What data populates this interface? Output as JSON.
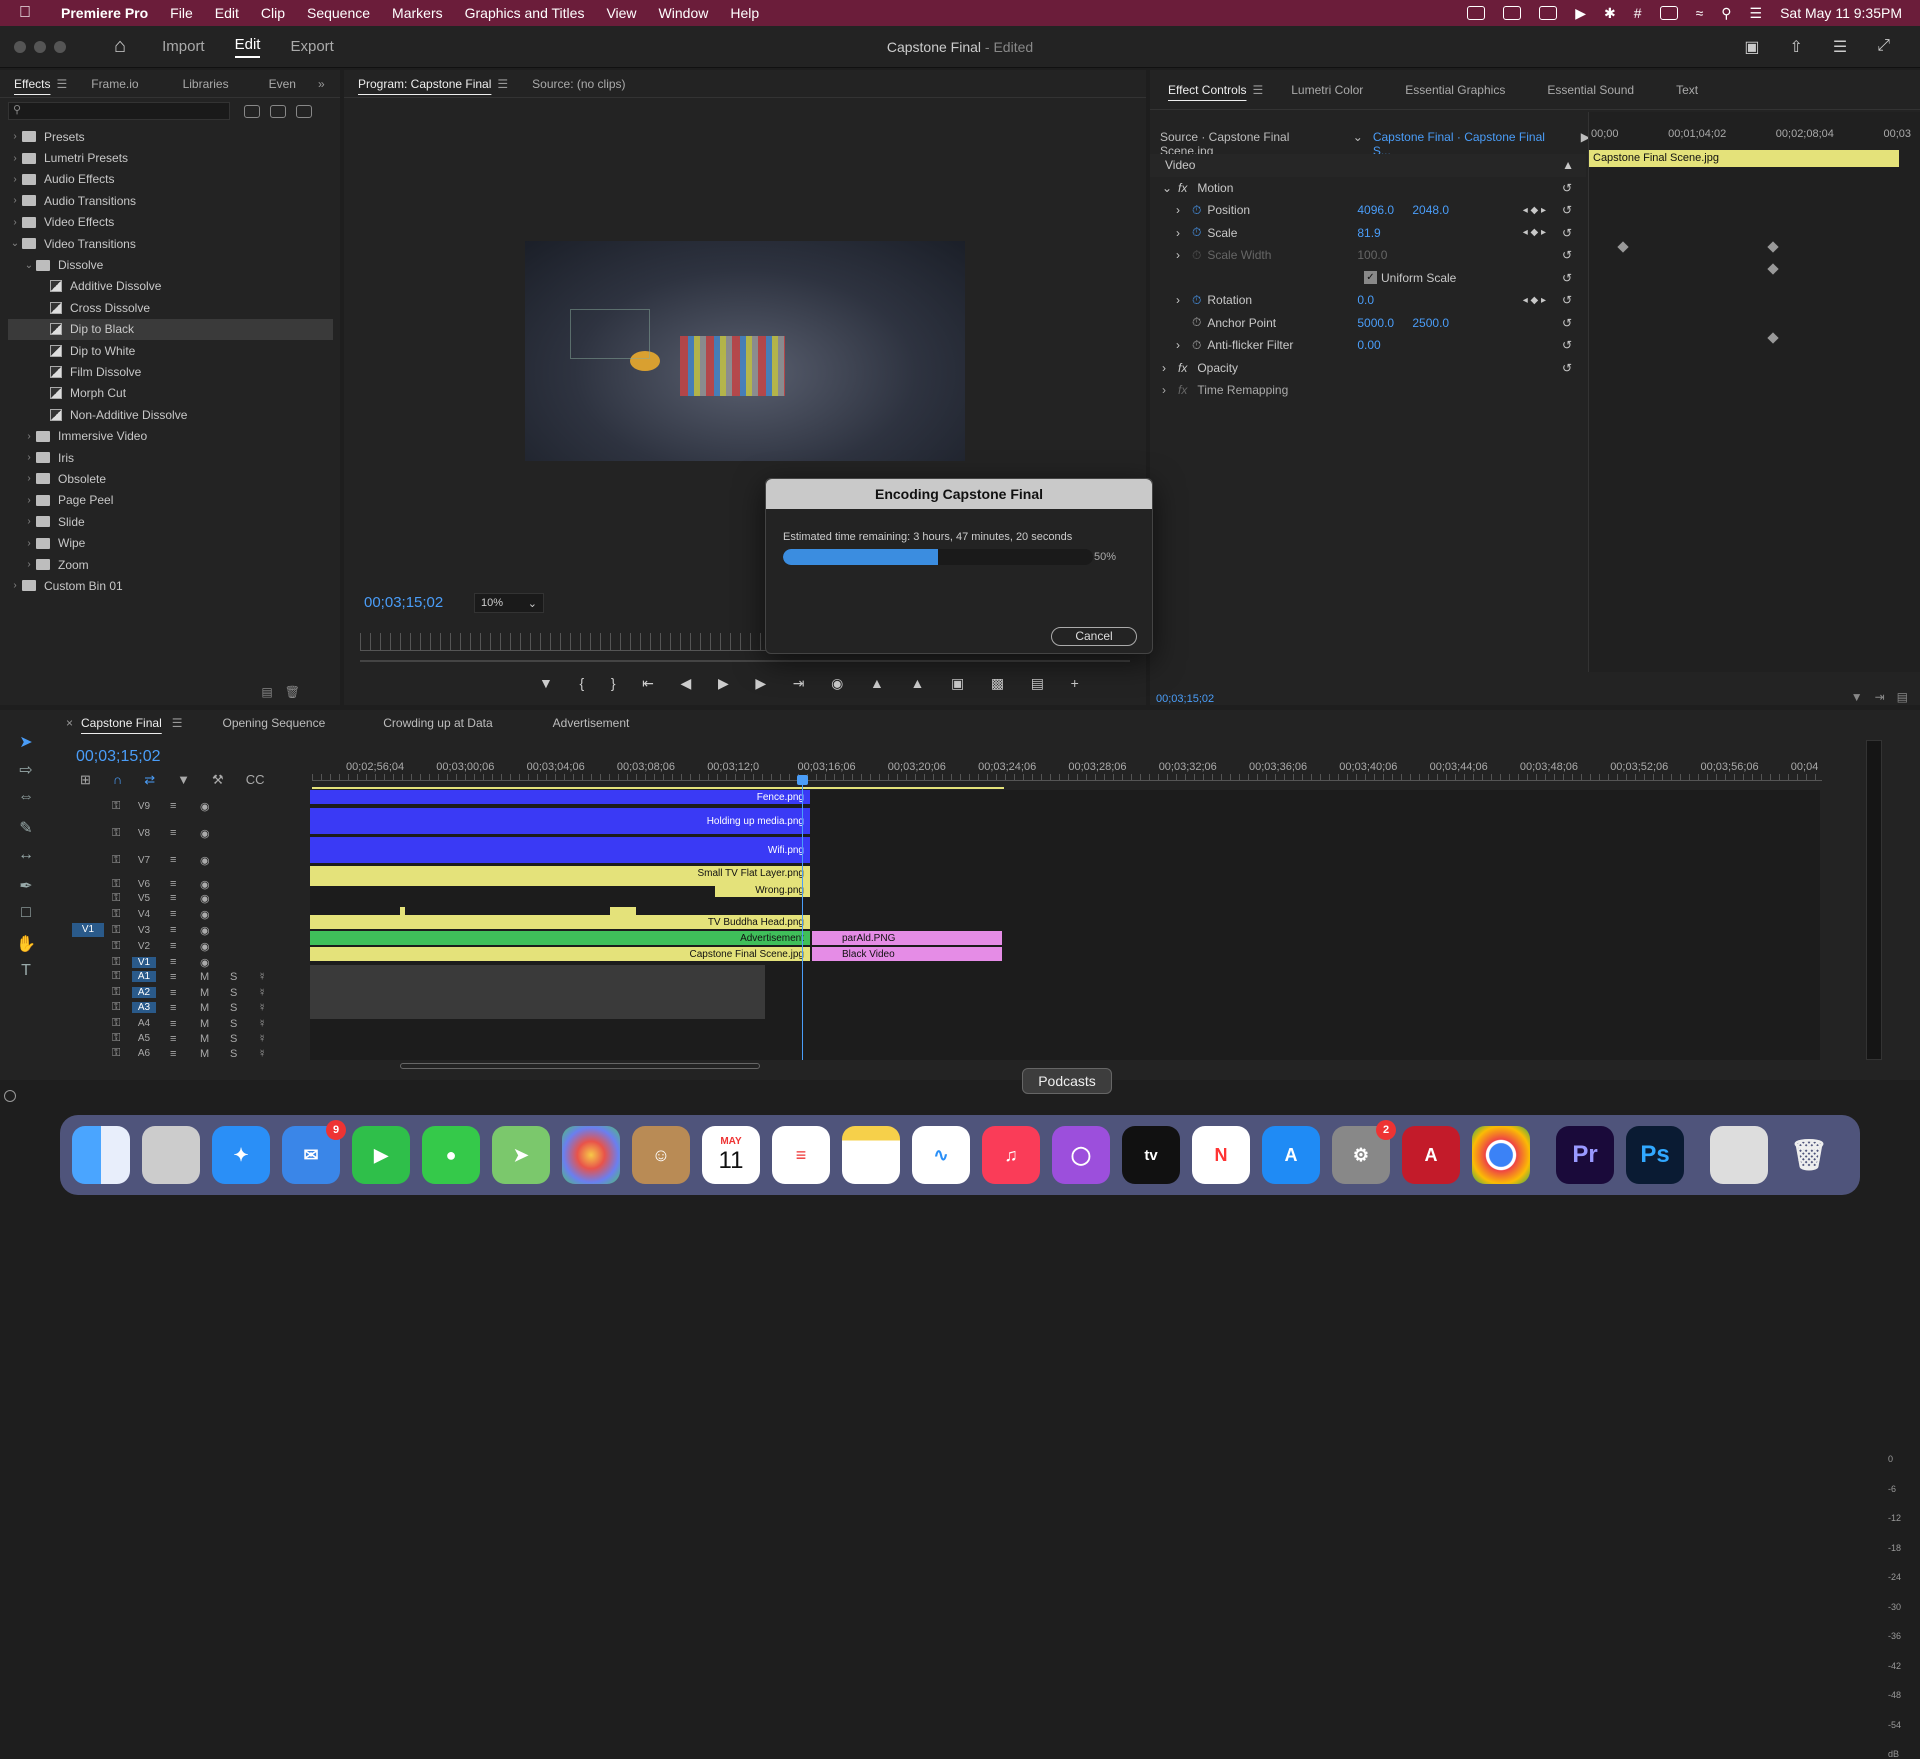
{
  "menubar": {
    "app_name": "Premiere Pro",
    "items": [
      "File",
      "Edit",
      "Clip",
      "Sequence",
      "Markers",
      "Graphics and Titles",
      "View",
      "Window",
      "Help"
    ],
    "datetime": "Sat May 11  9:35PM"
  },
  "header": {
    "tabs": [
      "Import",
      "Edit",
      "Export"
    ],
    "active_tab": "Edit",
    "doc_title": "Capstone Final",
    "doc_state": " - Edited"
  },
  "effects_panel": {
    "tabs": [
      "Effects",
      "Frame.io",
      "Libraries",
      "Even"
    ],
    "tree": [
      {
        "label": "Presets",
        "type": "folder",
        "level": 0
      },
      {
        "label": "Lumetri Presets",
        "type": "folder",
        "level": 0
      },
      {
        "label": "Audio Effects",
        "type": "folder",
        "level": 0
      },
      {
        "label": "Audio Transitions",
        "type": "folder",
        "level": 0
      },
      {
        "label": "Video Effects",
        "type": "folder",
        "level": 0
      },
      {
        "label": "Video Transitions",
        "type": "folder",
        "level": 0,
        "open": true
      },
      {
        "label": "Dissolve",
        "type": "folder",
        "level": 1,
        "open": true
      },
      {
        "label": "Additive Dissolve",
        "type": "fx",
        "level": 2
      },
      {
        "label": "Cross Dissolve",
        "type": "fx",
        "level": 2
      },
      {
        "label": "Dip to Black",
        "type": "fx",
        "level": 2,
        "selected": true
      },
      {
        "label": "Dip to White",
        "type": "fx",
        "level": 2
      },
      {
        "label": "Film Dissolve",
        "type": "fx",
        "level": 2
      },
      {
        "label": "Morph Cut",
        "type": "fx",
        "level": 2
      },
      {
        "label": "Non-Additive Dissolve",
        "type": "fx",
        "level": 2
      },
      {
        "label": "Immersive Video",
        "type": "folder",
        "level": 1
      },
      {
        "label": "Iris",
        "type": "folder",
        "level": 1
      },
      {
        "label": "Obsolete",
        "type": "folder",
        "level": 1
      },
      {
        "label": "Page Peel",
        "type": "folder",
        "level": 1
      },
      {
        "label": "Slide",
        "type": "folder",
        "level": 1
      },
      {
        "label": "Wipe",
        "type": "folder",
        "level": 1
      },
      {
        "label": "Zoom",
        "type": "folder",
        "level": 1
      },
      {
        "label": "Custom Bin 01",
        "type": "folder",
        "level": 0
      }
    ]
  },
  "program_monitor": {
    "tabs": [
      "Program: Capstone Final",
      "Source: (no clips)"
    ],
    "timecode": "00;03;15;02",
    "zoom": "10%"
  },
  "encoding_dialog": {
    "title": "Encoding Capstone Final",
    "status": "Estimated time remaining: 3 hours, 47 minutes, 20 seconds",
    "progress_percent": 50,
    "progress_label": "50%",
    "cancel_label": "Cancel"
  },
  "effect_controls": {
    "tabs": [
      "Effect Controls",
      "Lumetri Color",
      "Essential Graphics",
      "Essential Sound",
      "Text"
    ],
    "source": "Source · Capstone Final Scene.jpg",
    "sequence": "Capstone Final · Capstone Final S...",
    "ruler": [
      "00;00",
      "00;01;04;02",
      "00;02;08;04",
      "00;03"
    ],
    "clip_name": "Capstone Final Scene.jpg",
    "section_video": "Video",
    "motion": "Motion",
    "rows": [
      {
        "name": "Position",
        "v1": "4096.0",
        "v2": "2048.0"
      },
      {
        "name": "Scale",
        "v1": "81.9",
        "v2": ""
      },
      {
        "name": "Scale Width",
        "v1": "100.0",
        "v2": ""
      },
      {
        "name": "Uniform Scale",
        "v1": "",
        "v2": ""
      },
      {
        "name": "Rotation",
        "v1": "0.0",
        "v2": ""
      },
      {
        "name": "Anchor Point",
        "v1": "5000.0",
        "v2": "2500.0"
      },
      {
        "name": "Anti-flicker Filter",
        "v1": "0.00",
        "v2": ""
      }
    ],
    "opacity": "Opacity",
    "time_remap": "Time Remapping",
    "timecode": "00;03;15;02"
  },
  "timeline": {
    "tabs": [
      "Capstone Final",
      "Opening Sequence",
      "Crowding up at Data",
      "Advertisement"
    ],
    "timecode": "00;03;15;02",
    "ruler": [
      "00;02;56;04",
      "00;03;00;06",
      "00;03;04;06",
      "00;03;08;06",
      "00;03;12;0",
      "00;03;16;06",
      "00;03;20;06",
      "00;03;24;06",
      "00;03;28;06",
      "00;03;32;06",
      "00;03;36;06",
      "00;03;40;06",
      "00;03;44;06",
      "00;03;48;06",
      "00;03;52;06",
      "00;03;56;06",
      "00;04"
    ],
    "video_tracks": [
      "V9",
      "V8",
      "V7",
      "V6",
      "V5",
      "V4",
      "V3",
      "V2",
      "V1"
    ],
    "audio_tracks": [
      "A1",
      "A2",
      "A3",
      "A4",
      "A5",
      "A6"
    ],
    "source_patch": "V1",
    "track_letters": {
      "mute": "M",
      "solo": "S"
    },
    "clips": {
      "fence": "Fence.png",
      "holding": "Holding up media.png",
      "wifi": "Wifi.png",
      "small_tv": "Small TV Flat Layer.png",
      "wrong": "Wrong.png",
      "tv_buddha": "TV Buddha Head.png",
      "advertisement": "Advertisement",
      "parald": "parAld.PNG",
      "capstone": "Capstone Final Scene.jpg",
      "black_video": "Black Video"
    },
    "meter_labels": [
      "0",
      "-6",
      "-12",
      "-18",
      "-24",
      "-30",
      "-36",
      "-42",
      "-48",
      "-54",
      "dB"
    ]
  },
  "dock": {
    "tooltip": "Podcasts",
    "mail_badge": "9",
    "settings_badge": "2",
    "calendar_month": "MAY",
    "calendar_day": "11"
  },
  "colors": {
    "accent_blue": "#4a9df8",
    "clip_blue": "#3a3af5",
    "clip_yellow": "#e4e27a",
    "clip_green": "#3fbf5a",
    "clip_pink": "#e58ce6"
  }
}
